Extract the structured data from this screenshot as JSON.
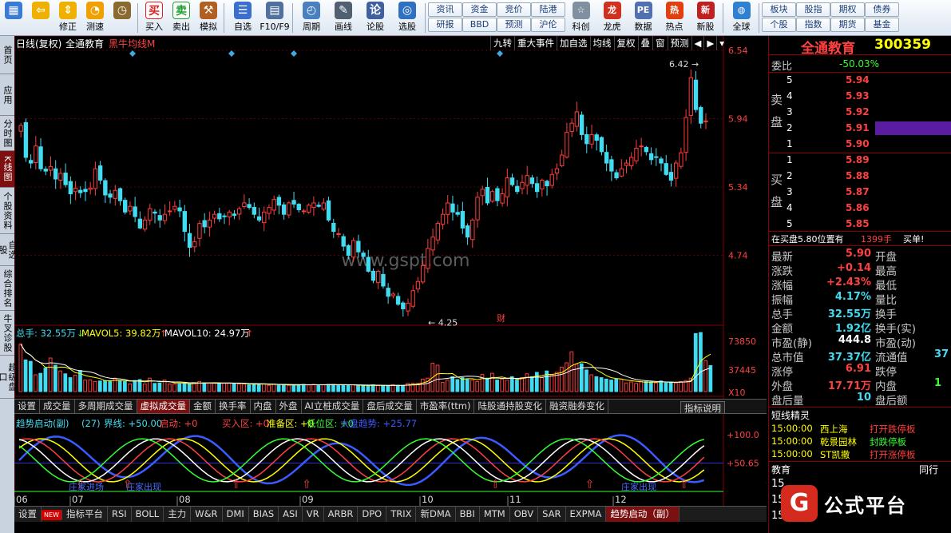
{
  "toolbar": {
    "buttons": [
      {
        "label": "",
        "icon": "windows-icon"
      },
      {
        "label": "",
        "icon": "back-arrow-icon"
      },
      {
        "label": "修正",
        "icon": "up-down-arrows-icon"
      },
      {
        "label": "测速",
        "icon": "speed-icon"
      },
      {
        "label": "",
        "icon": "clock-icon"
      },
      {
        "label": "买入",
        "icon": "buy-icon"
      },
      {
        "label": "卖出",
        "icon": "sell-icon"
      },
      {
        "label": "模拟",
        "icon": "hammer-icon"
      },
      {
        "label": "自选",
        "icon": "watchlist-icon"
      },
      {
        "label": "F10/F9",
        "icon": "f10-icon"
      },
      {
        "label": "周期",
        "icon": "period-icon"
      },
      {
        "label": "画线",
        "icon": "pencil-icon"
      },
      {
        "label": "论股",
        "icon": "discuss-icon"
      },
      {
        "label": "选股",
        "icon": "stock-picker-icon"
      }
    ],
    "grid1": [
      [
        "资讯",
        "研报"
      ],
      [
        "资金",
        "BBD"
      ],
      [
        "竞价",
        "预测"
      ],
      [
        "陆港",
        "沪伦"
      ]
    ],
    "buttons2": [
      {
        "label": "科创",
        "icon": "star-market-icon"
      },
      {
        "label": "龙虎",
        "icon": "dragon-tiger-icon"
      },
      {
        "label": "数据",
        "icon": "pe-data-icon"
      },
      {
        "label": "热点",
        "icon": "hot-icon"
      },
      {
        "label": "新股",
        "icon": "ipo-icon"
      },
      {
        "label": "全球",
        "icon": "globe-icon"
      }
    ],
    "grid2": [
      [
        "板块",
        "个股"
      ],
      [
        "股指",
        "指数"
      ],
      [
        "期权",
        "期货"
      ],
      [
        "债券",
        "基金"
      ]
    ]
  },
  "left_tabs": [
    "首页",
    "应用",
    "分时图",
    "K线图",
    "个股资料",
    "自选股",
    "综合排名",
    "牛叉诊股",
    "超级盘口"
  ],
  "chart_header": {
    "period": "日线(复权)",
    "name": "全通教育",
    "indicator": "黑牛均线M",
    "buttons": [
      "九转",
      "重大事件",
      "加自选",
      "均线",
      "复权",
      "叠",
      "窗",
      "预测"
    ]
  },
  "chart_data": [
    {
      "type": "candlestick",
      "title": "全通教育",
      "x_ticks": [
        "06",
        "07",
        "08",
        "09",
        "10",
        "11",
        "12"
      ],
      "y_ticks": [
        6.54,
        5.94,
        5.34,
        4.74
      ],
      "ylim": [
        4.14,
        6.54
      ],
      "annotations": [
        {
          "text": "6.42",
          "value": 6.42
        },
        {
          "text": "4.25",
          "value": 4.25
        },
        {
          "text": "财"
        }
      ],
      "series": [
        {
          "name": "close",
          "values": [
            5.88,
            5.6,
            5.55,
            5.7,
            5.5,
            5.48,
            5.52,
            5.41,
            5.46,
            5.36,
            5.28,
            5.33,
            5.29,
            5.3,
            5.33,
            5.5,
            5.4,
            5.27,
            5.25,
            5.31,
            5.22,
            5.12,
            5.17,
            5.08,
            4.98,
            5.05,
            5.15,
            5.11,
            5.05,
            5.1,
            5.13,
            5.17,
            5.13,
            4.95,
            4.81,
            4.86,
            5.02,
            4.99,
            5.05,
            5.1,
            5.06,
            5.08,
            5.12,
            5.09,
            5.15,
            5.2,
            5.16,
            5.1,
            5.05,
            5.12,
            5.16,
            5.23,
            5.18,
            5.1,
            5.2,
            5.19,
            5.14,
            5.13,
            5.18,
            5.2,
            5.17,
            5.2,
            5.05,
            4.95,
            4.93,
            4.82,
            4.74,
            4.87,
            4.77,
            4.73,
            4.6,
            4.52,
            4.6,
            4.47,
            4.38,
            4.4,
            4.31,
            4.27,
            4.32,
            4.43,
            4.51,
            4.65,
            4.8,
            4.9,
            5.02,
            5.1,
            5.2,
            5.12,
            5.1,
            4.98,
            4.9,
            5.05,
            5.25,
            5.32,
            5.2,
            5.3,
            5.22,
            5.28,
            5.42,
            5.36,
            5.3,
            5.38,
            5.44,
            5.37,
            5.3,
            5.4,
            5.35,
            5.45,
            5.5,
            5.62,
            5.82,
            5.9,
            6.0,
            5.8,
            5.72,
            5.8,
            5.75,
            5.65,
            5.55,
            5.48,
            5.42,
            5.5,
            5.55,
            5.6,
            5.68,
            5.7,
            5.65,
            5.58,
            5.6,
            5.55,
            5.45,
            5.4,
            5.55,
            5.64,
            5.95,
            6.3,
            6.02,
            5.9,
            5.92
          ]
        }
      ]
    },
    {
      "type": "bar",
      "title": "总手",
      "legend": [
        {
          "text": "总手: 32.55万",
          "color": "#41dcf2"
        },
        {
          "text": "MAVOL5: 39.82万",
          "color": "#ffff00"
        },
        {
          "text": "MAVOL10: 24.97万",
          "color": "#ffffff"
        }
      ],
      "y_ticks": [
        "73850",
        "37445",
        "X10"
      ],
      "ylim": [
        0,
        80000
      ],
      "values": [
        59400,
        39600,
        37800,
        21000,
        22800,
        29400,
        42000,
        33000,
        25800,
        22200,
        17400,
        20400,
        26400,
        14400,
        14400,
        12600,
        13200,
        13800,
        13200,
        16800,
        13200,
        12600,
        9600,
        13800,
        15000,
        9600,
        16800,
        10200,
        10800,
        14400,
        9600,
        9600,
        9600,
        10200,
        9600,
        10800,
        12600,
        10800,
        10800,
        10800,
        10200,
        10800,
        10800,
        9600,
        9600,
        9600,
        8400,
        9600,
        9600,
        9600,
        7800,
        9000,
        7800,
        9000,
        7800,
        8400,
        8400,
        9000,
        8400,
        9000,
        8400,
        8400,
        9000,
        9000,
        8400,
        8400,
        7800,
        8400,
        7200,
        7200,
        7800,
        8400,
        7800,
        7200,
        7200,
        8400,
        7800,
        7800,
        10200,
        10200,
        10200,
        15600,
        16800,
        35400,
        33000,
        11400,
        14400,
        18600,
        15000,
        17400,
        15000,
        14400,
        12600,
        21600,
        16800,
        22800,
        14400,
        15600,
        14400,
        18600,
        14400,
        17400,
        22200,
        18600,
        24000,
        17400,
        25800,
        21000,
        24000,
        30600,
        36000,
        49800,
        34200,
        34800,
        27000,
        21000,
        18600,
        17400,
        15600,
        14400,
        15600,
        15600,
        10800,
        12000,
        10200,
        12600,
        12600,
        12000,
        10800,
        13200,
        10800,
        12000,
        10800,
        12600,
        13800,
        16800,
        72600,
        73850,
        38400,
        32550
      ]
    },
    {
      "type": "line",
      "title": "趋势启动(副)",
      "params": "(27)",
      "legend": [
        {
          "text": "界线: +50.00",
          "color": "#41dcf2"
        },
        {
          "text": "启动: +0",
          "color": "#ff4040"
        },
        {
          "text": "买入区: +0",
          "color": "#ff4040"
        },
        {
          "text": "准备区: +0",
          "color": "#ffff00"
        },
        {
          "text": "低位区: +0",
          "color": "#33ff33"
        },
        {
          "text": "大盘趋势: +25.77",
          "color": "#3a5bff"
        }
      ],
      "y_ticks": [
        "+100.0",
        "+50.65"
      ],
      "ylim": [
        0,
        110
      ],
      "markers": [
        "庄家进场",
        "庄家出现",
        "庄家出现"
      ]
    }
  ],
  "vol_tabs": [
    "设置",
    "成交量",
    "多周期成交量",
    "虚拟成交量",
    "金额",
    "换手率",
    "内盘",
    "外盘",
    "AI立桩成交量",
    "盘后成交量",
    "市盈率(ttm)",
    "陆股通持股变化",
    "融资融券变化"
  ],
  "vol_tab_active": "虚拟成交量",
  "indicator_explain": "指标说明",
  "watermark": "www.gspt.com",
  "bottom_tabs": [
    "设置",
    "NEW",
    "指标平台",
    "RSI",
    "BOLL",
    "主力",
    "W&R",
    "DMI",
    "BIAS",
    "ASI",
    "VR",
    "ARBR",
    "DPO",
    "TRIX",
    "新DMA",
    "BBI",
    "MTM",
    "OBV",
    "SAR",
    "EXPMA",
    "趋势启动（副）"
  ],
  "bottom_tab_active": "趋势启动（副）",
  "quote": {
    "name": "全通教育",
    "code": "300359",
    "weibi_label": "委比",
    "weibi": "-50.03%",
    "sell_label": "卖盘",
    "buy_label": "买盘",
    "sell": [
      [
        "5",
        "5.94"
      ],
      [
        "4",
        "5.93"
      ],
      [
        "3",
        "5.92"
      ],
      [
        "2",
        "5.91"
      ],
      [
        "1",
        "5.90"
      ]
    ],
    "buy": [
      [
        "1",
        "5.89"
      ],
      [
        "2",
        "5.88"
      ],
      [
        "3",
        "5.87"
      ],
      [
        "4",
        "5.86"
      ],
      [
        "5",
        "5.85"
      ]
    ],
    "notice": "在买盘5.80位置有",
    "notice_qty": "1399手",
    "notice_act": "买单!",
    "stats": [
      [
        "最新",
        "5.90",
        "开盘",
        ""
      ],
      [
        "涨跌",
        "+0.14",
        "最高",
        ""
      ],
      [
        "涨幅",
        "+2.43%",
        "最低",
        ""
      ],
      [
        "振幅",
        "4.17%",
        "量比",
        ""
      ],
      [
        "总手",
        "32.55万",
        "换手",
        ""
      ],
      [
        "金额",
        "1.92亿",
        "换手(实)",
        ""
      ],
      [
        "市盈(静)",
        "444.8",
        "市盈(动)",
        ""
      ],
      [
        "总市值",
        "37.37亿",
        "流通值",
        "37"
      ],
      [
        "涨停",
        "6.91",
        "跌停",
        ""
      ],
      [
        "外盘",
        "17.71万",
        "内盘",
        "1"
      ],
      [
        "盘后量",
        "10",
        "盘后额",
        ""
      ]
    ],
    "short_title": "短线精灵",
    "short": [
      [
        "15:00:00",
        "西上海",
        "打开跌停板"
      ],
      [
        "15:00:00",
        "乾景园林",
        "封跌停板"
      ],
      [
        "15:00:00",
        "ST凯撒",
        "打开涨停板"
      ]
    ],
    "sector_label": "教育",
    "sector_extra": "同行",
    "peers": [
      "15",
      "15",
      "15"
    ]
  },
  "logo": {
    "badge": "G",
    "text": "公式平台"
  }
}
